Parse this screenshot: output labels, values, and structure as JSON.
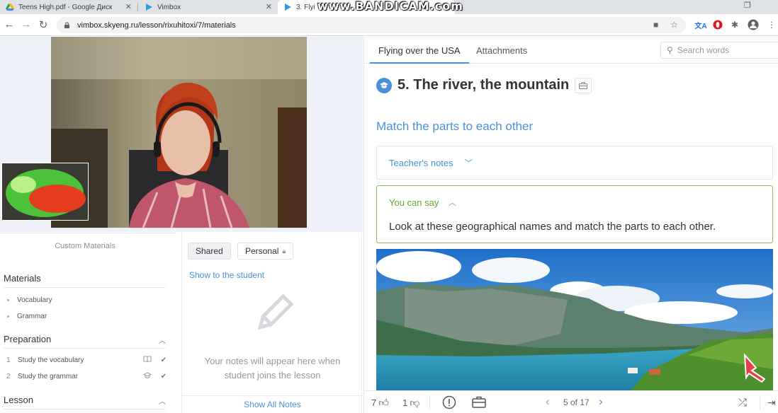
{
  "browser": {
    "tabs": [
      {
        "title": "Teens High.pdf - Google Диск",
        "close": "✕"
      },
      {
        "title": "Vimbox",
        "close": "✕"
      },
      {
        "title": "3. Flyi",
        "close": ""
      }
    ],
    "watermark": "www.BANDICAM.com",
    "url": "vimbox.skyeng.ru/lesson/rixuhitoxi/7/materials",
    "nav_icons": [
      "back-icon",
      "forward-icon",
      "reload-icon"
    ],
    "extensions": [
      "translate-icon",
      "opera-icon",
      "puzzle-icon",
      "profile-icon",
      "menu-icon"
    ]
  },
  "sidebar": {
    "header": "Custom Materials",
    "materials": {
      "title": "Materials",
      "items": [
        "Vocabulary",
        "Grammar"
      ]
    },
    "preparation": {
      "title": "Preparation",
      "items": [
        {
          "num": "1",
          "label": "Study the vocabulary"
        },
        {
          "num": "2",
          "label": "Study the grammar"
        }
      ]
    },
    "lesson": {
      "title": "Lesson"
    }
  },
  "notes": {
    "tab_shared": "Shared",
    "tab_personal": "Personal",
    "show_to_student": "Show to the student",
    "empty_text": "Your notes will appear here when student joins the lesson",
    "show_all": "Show All Notes"
  },
  "content": {
    "tabs": [
      "Flying over the USA",
      "Attachments"
    ],
    "search_placeholder": "Search words",
    "lesson_title": "5. The river, the mountain",
    "task_title": "Match the parts to each other",
    "teacher_notes": "Teacher's notes",
    "you_can_say": "You can say",
    "you_can_say_text": "Look at these geographical names and match the parts to each other.",
    "likes": "7",
    "dislikes": "1",
    "pager": "5 of 17"
  },
  "colors": {
    "accent": "#4a90d9",
    "green": "#8cc152",
    "chrome": "#dee1e6"
  }
}
